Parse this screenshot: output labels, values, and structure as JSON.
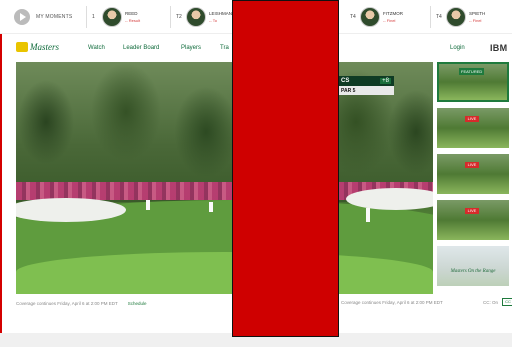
{
  "ticker": {
    "moments_label": "MY MOMENTS",
    "players": [
      {
        "pos": "1",
        "name": "REED",
        "score": "-- Result"
      },
      {
        "pos": "T2",
        "name": "LEISHMAN",
        "score": "-- To"
      },
      {
        "pos": "T4",
        "name": "FITZMOR",
        "score": "-- Finel"
      },
      {
        "pos": "T4",
        "name": "SPIETH",
        "score": "-- Finel"
      }
    ]
  },
  "nav": {
    "logo_text": "Masters",
    "items": [
      "Watch",
      "Leader Board",
      "Players",
      "Tra"
    ],
    "login": "Login",
    "ibm": "IBM"
  },
  "video": {
    "overlay_name": "CS",
    "overlay_score": "+8",
    "overlay_par": "PAR 5"
  },
  "thumbs": [
    {
      "title": "",
      "live": "",
      "tag": "FEATURED"
    },
    {
      "title": "",
      "live": "LIVE"
    },
    {
      "title": "",
      "live": "LIVE"
    },
    {
      "title": "",
      "live": "LIVE"
    },
    {
      "title": "Masters On the Range",
      "live": ""
    }
  ],
  "caption": {
    "left_text": "Coverage continues Friday, April 6 at 2:00 PM EDT",
    "schedule_link": "Schedule",
    "right_text": "Coverage continues Friday, April 6 at 2:00 PM EDT",
    "cc_label": "CC: On",
    "cc_toggle": "CC"
  },
  "colors": {
    "masters_green": "#0e6a3a",
    "occluder_red": "#cf0000"
  }
}
